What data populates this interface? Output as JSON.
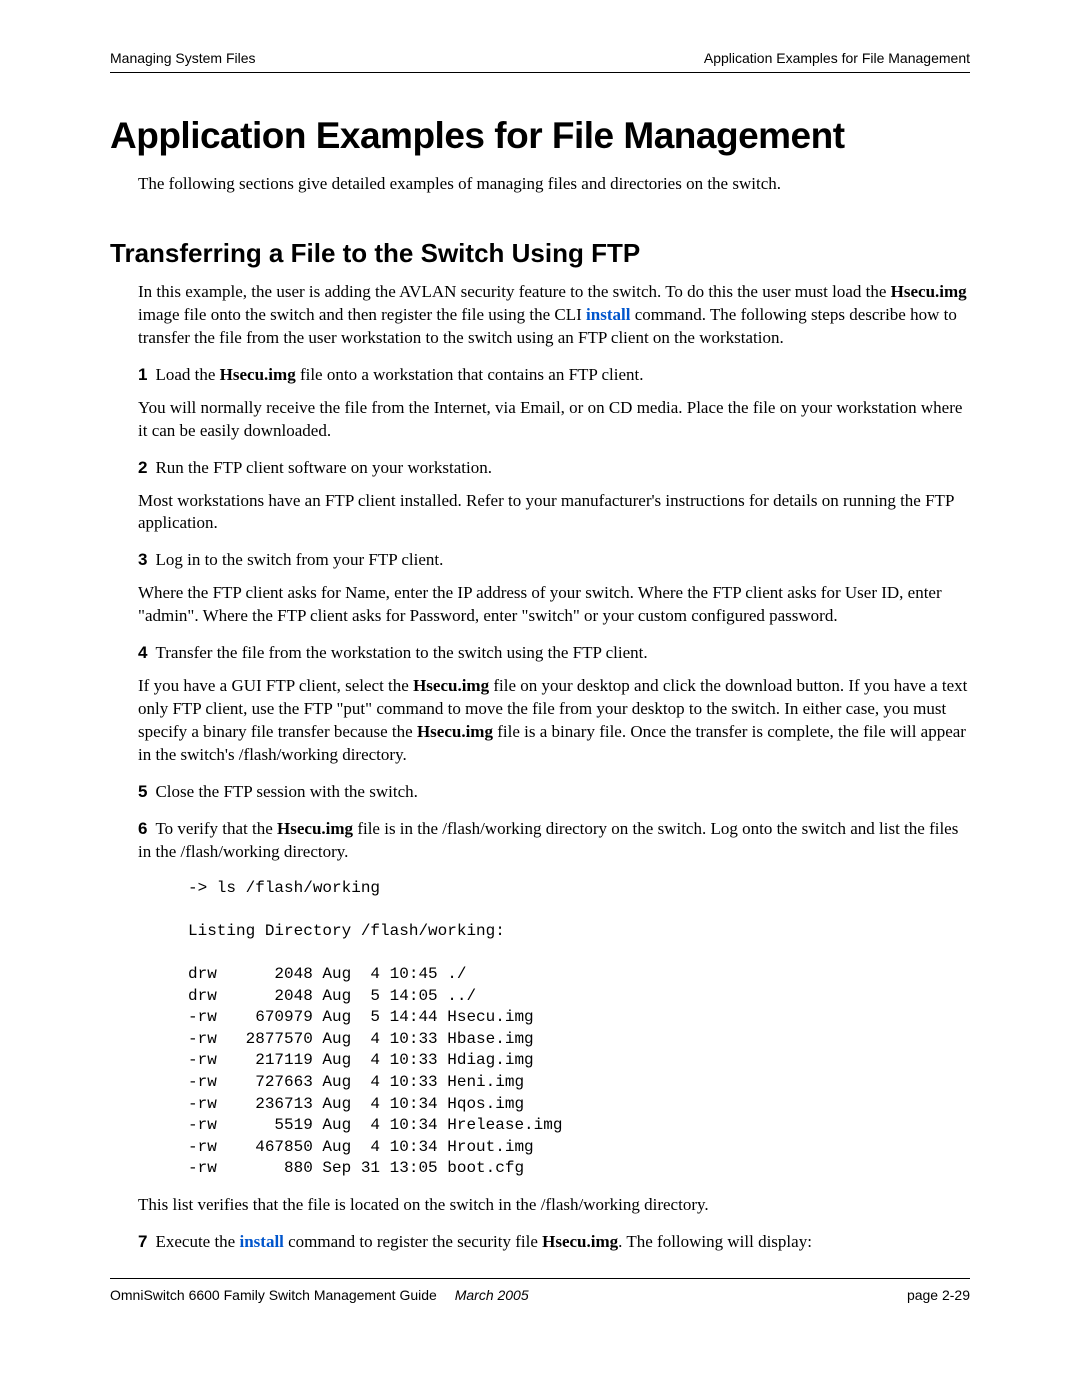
{
  "header": {
    "left": "Managing System Files",
    "right": "Application Examples for File Management"
  },
  "title": "Application Examples for File Management",
  "intro": "The following sections give detailed examples of managing files and directories on the switch.",
  "section": {
    "title": "Transferring a File to the Switch Using FTP",
    "p1_a": "In this example, the user is adding the AVLAN security feature to the switch. To do this the user must load the ",
    "p1_bold1": "Hsecu.img",
    "p1_b": " image file onto the switch and then register the file using the CLI ",
    "p1_cmd": "install",
    "p1_c": " command. The following steps describe how to transfer the file from the user workstation to the switch using an FTP client on the workstation.",
    "s1_num": "1",
    "s1_a": "Load the ",
    "s1_bold": "Hsecu.img",
    "s1_b": " file onto a workstation that contains an FTP client.",
    "p2": "You will normally receive the file from the Internet, via Email, or on CD media. Place the file on your workstation where it can be easily downloaded.",
    "s2_num": "2",
    "s2": "Run the FTP client software on your workstation.",
    "p3": "Most workstations have an FTP client installed. Refer to your manufacturer's instructions for details on running the FTP application.",
    "s3_num": "3",
    "s3": "Log in to the switch from your FTP client.",
    "p4": "Where the FTP client asks for Name, enter the IP address of your switch. Where the FTP client asks for User ID, enter \"admin\". Where the FTP client asks for Password, enter \"switch\" or your custom configured password.",
    "s4_num": "4",
    "s4": "Transfer the file from the workstation to the switch using the FTP client.",
    "p5_a": "If you have a GUI FTP client, select the ",
    "p5_bold1": "Hsecu.img",
    "p5_b": " file on your desktop and click the download button. If you have a text only FTP client, use the FTP \"put\" command to move the file from your desktop to the switch. In either case, you must specify a binary file transfer because the ",
    "p5_bold2": "Hsecu.img",
    "p5_c": " file is a binary file. Once the transfer is complete, the file will appear in the switch's /flash/working directory.",
    "s5_num": "5",
    "s5": "Close the FTP session with the switch.",
    "s6_num": "6",
    "s6_a": "To verify that the ",
    "s6_bold": "Hsecu.img",
    "s6_b": " file is in the /flash/working directory on the switch. Log onto the switch and list the files in the /flash/working directory.",
    "listing": "-> ls /flash/working\n\nListing Directory /flash/working:\n\ndrw      2048 Aug  4 10:45 ./\ndrw      2048 Aug  5 14:05 ../\n-rw    670979 Aug  5 14:44 Hsecu.img\n-rw   2877570 Aug  4 10:33 Hbase.img\n-rw    217119 Aug  4 10:33 Hdiag.img\n-rw    727663 Aug  4 10:33 Heni.img\n-rw    236713 Aug  4 10:34 Hqos.img\n-rw      5519 Aug  4 10:34 Hrelease.img\n-rw    467850 Aug  4 10:34 Hrout.img\n-rw       880 Sep 31 13:05 boot.cfg",
    "p6": "This list verifies that the file is located on the switch in the /flash/working directory.",
    "s7_num": "7",
    "s7_a": "Execute the ",
    "s7_cmd": "install",
    "s7_b": " command to register the security file ",
    "s7_bold": "Hsecu.img",
    "s7_c": ". The following will display:"
  },
  "footer": {
    "guide": "OmniSwitch 6600 Family Switch Management Guide",
    "date": "March 2005",
    "page": "page 2-29"
  }
}
